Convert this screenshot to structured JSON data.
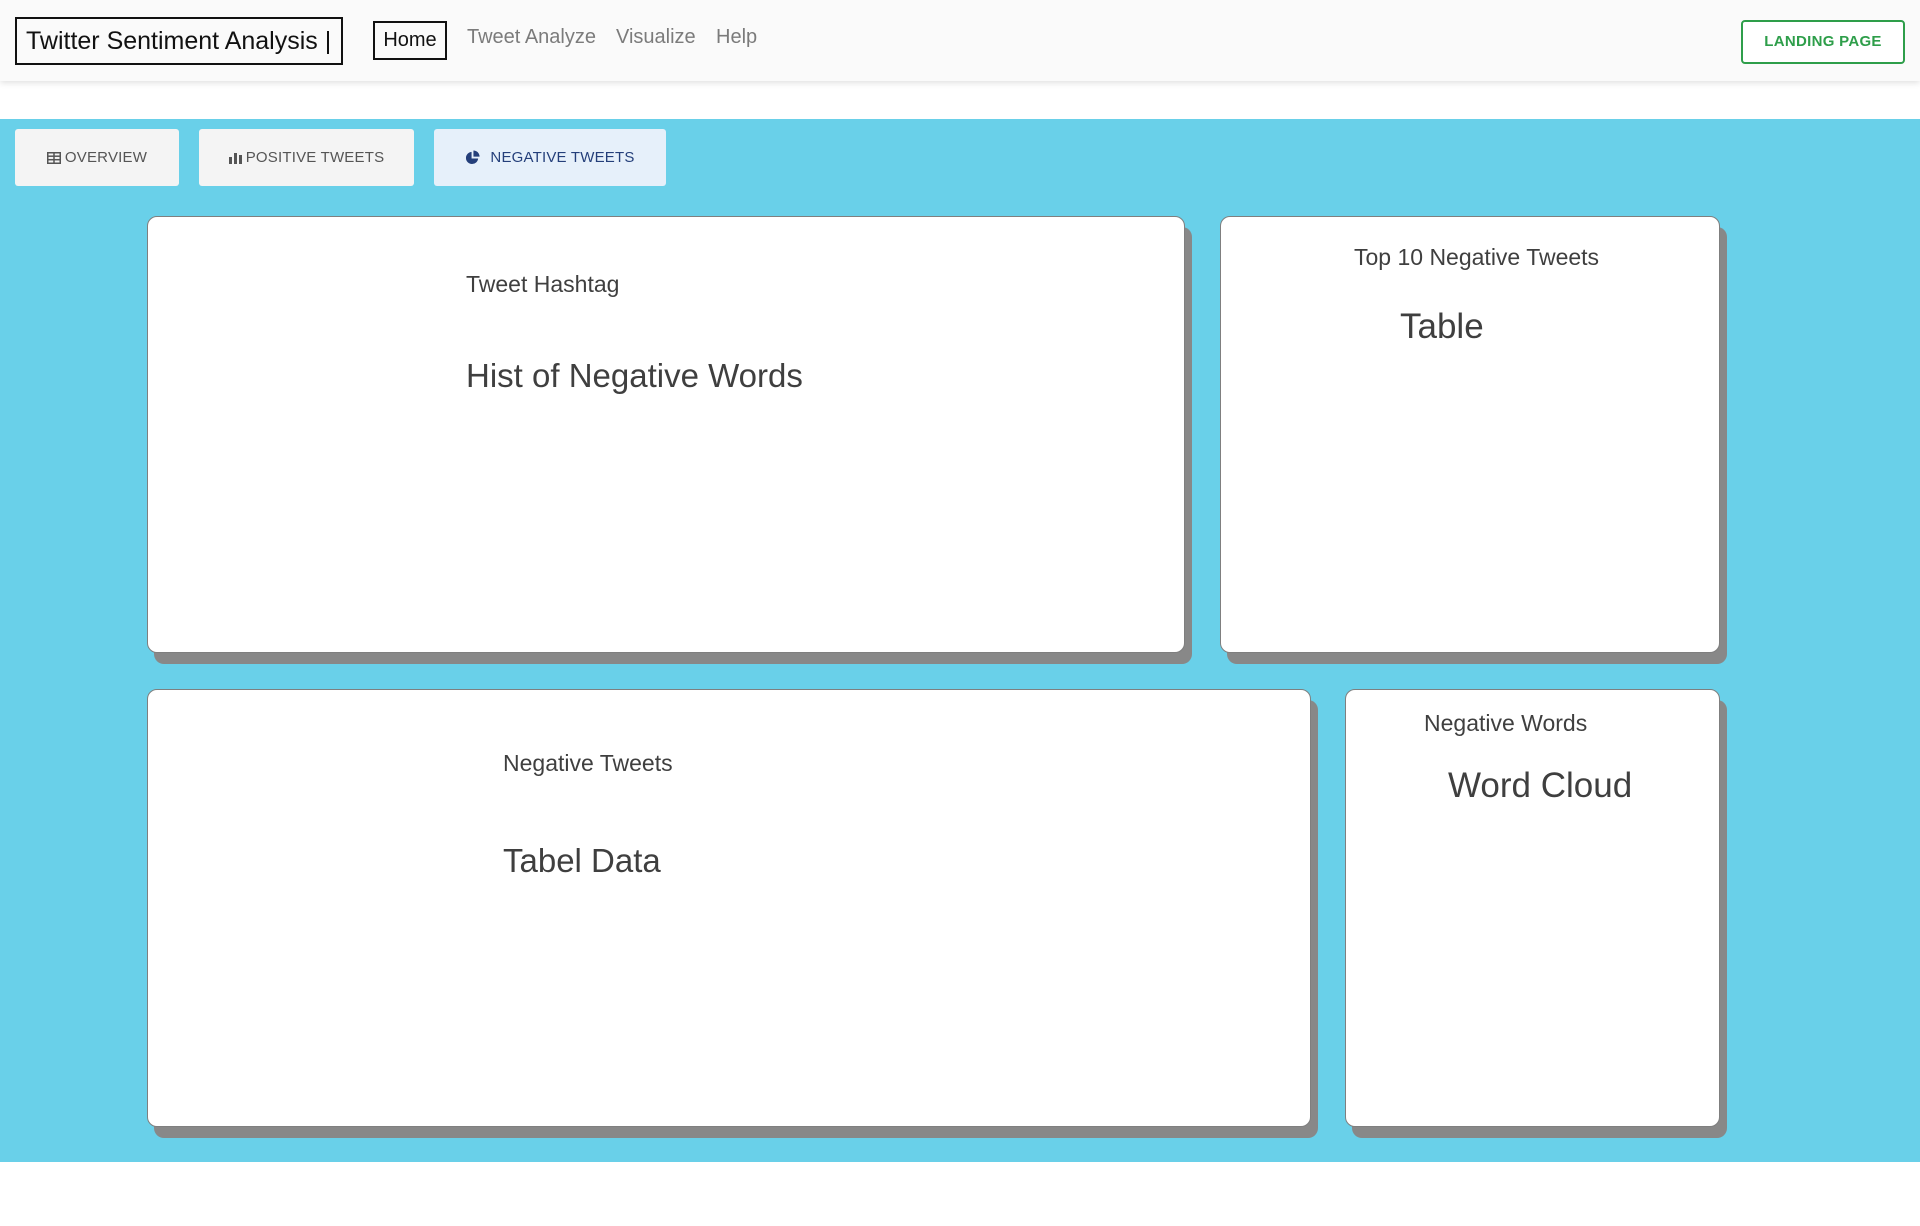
{
  "navbar": {
    "brand": "Twitter Sentiment Analysis |",
    "links": {
      "home": "Home",
      "tweet_analyze": "Tweet Analyze",
      "visualize": "Visualize",
      "help": "Help"
    },
    "landing_button": "LANDING PAGE"
  },
  "tabs": {
    "overview": {
      "label": "OVERVIEW",
      "icon": "table-icon"
    },
    "positive": {
      "label": "POSITIVE TWEETS",
      "icon": "bar-chart-icon"
    },
    "negative": {
      "label": "NEGATIVE TWEETS",
      "icon": "pie-chart-icon",
      "active": true
    }
  },
  "cards": {
    "hashtag": {
      "subtitle": "Tweet Hashtag",
      "content": "Hist of Negative Words"
    },
    "top10": {
      "subtitle": "Top 10 Negative Tweets",
      "content": "Table"
    },
    "negative_tweets": {
      "subtitle": "Negative Tweets",
      "content": "Tabel Data"
    },
    "negative_words": {
      "subtitle": "Negative Words",
      "content": "Word Cloud"
    }
  },
  "colors": {
    "main_background": "#69d0e9",
    "landing_button": "#2e9e4a",
    "active_tab_text": "#243f7a"
  }
}
